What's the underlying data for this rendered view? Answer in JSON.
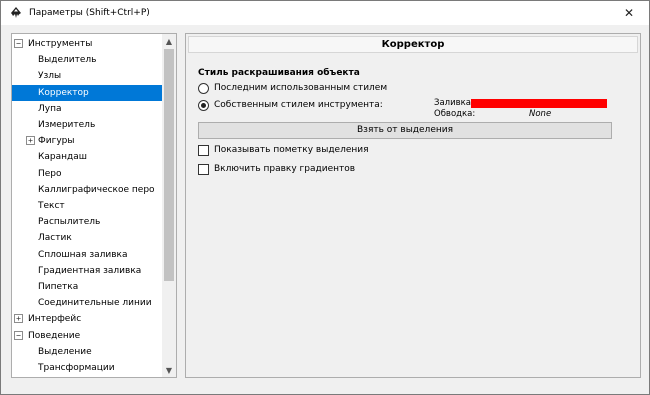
{
  "window": {
    "title": "Параметры (Shift+Ctrl+P)",
    "close_glyph": "✕"
  },
  "tree": {
    "items": [
      {
        "label": "Инструменты",
        "level": 0,
        "expander": "−"
      },
      {
        "label": "Выделитель",
        "level": 1
      },
      {
        "label": "Узлы",
        "level": 1
      },
      {
        "label": "Корректор",
        "level": 1,
        "selected": true
      },
      {
        "label": "Лупа",
        "level": 1
      },
      {
        "label": "Измеритель",
        "level": 1
      },
      {
        "label": "Фигуры",
        "level": 1,
        "expander": "+"
      },
      {
        "label": "Карандаш",
        "level": 1
      },
      {
        "label": "Перо",
        "level": 1
      },
      {
        "label": "Каллиграфическое перо",
        "level": 1
      },
      {
        "label": "Текст",
        "level": 1
      },
      {
        "label": "Распылитель",
        "level": 1
      },
      {
        "label": "Ластик",
        "level": 1
      },
      {
        "label": "Сплошная заливка",
        "level": 1
      },
      {
        "label": "Градиентная заливка",
        "level": 1
      },
      {
        "label": "Пипетка",
        "level": 1
      },
      {
        "label": "Соединительные линии",
        "level": 1
      },
      {
        "label": "Интерфейс",
        "level": 0,
        "expander": "+"
      },
      {
        "label": "Поведение",
        "level": 0,
        "expander": "−"
      },
      {
        "label": "Выделение",
        "level": 1
      },
      {
        "label": "Трансформации",
        "level": 1
      }
    ]
  },
  "panel": {
    "title": "Корректор",
    "section_title": "Стиль раскрашивания объекта",
    "radio_last": "Последним использованным стилем",
    "radio_own": "Собственным стилем инструмента:",
    "fill_label": "Заливка:",
    "fill_color": "#ff0000",
    "stroke_label": "Обводка:",
    "stroke_value": "None",
    "take_button": "Взять от выделения",
    "check_marks": "Показывать пометку выделения",
    "check_gradients": "Включить правку градиентов"
  }
}
